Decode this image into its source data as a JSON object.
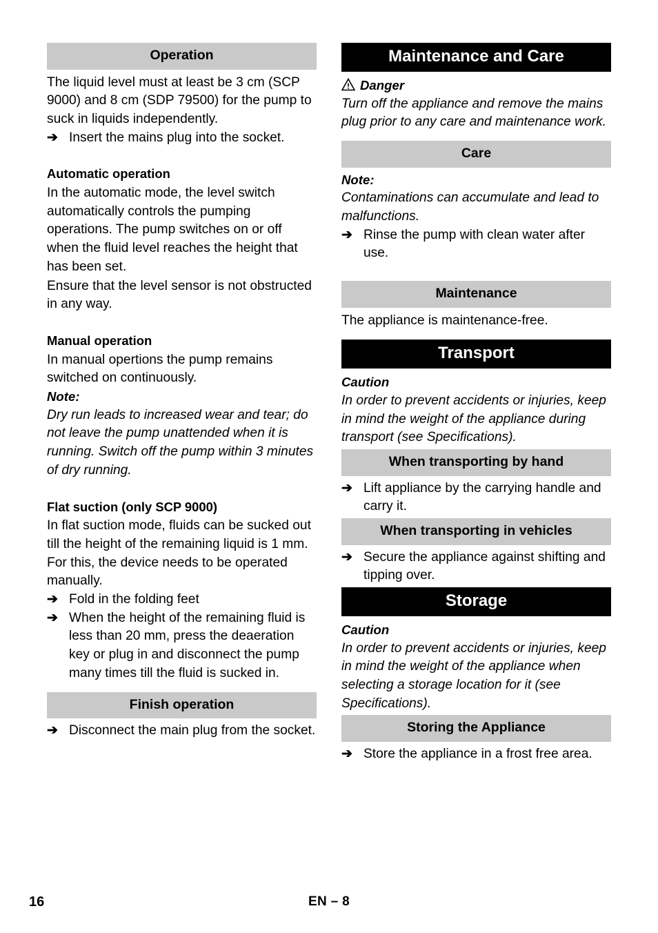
{
  "document": {
    "language_code": "EN",
    "page_number": "16",
    "footer_label": "EN – 8"
  },
  "left_column": {
    "operation_bar": "Operation",
    "intro_paragraph": "The liquid level must at least be 3 cm (SCP 9000) and 8 cm (SDP 79500) for the pump to suck in liquids independently.",
    "intro_step": "Insert the mains plug into the socket.",
    "automatic": {
      "heading": "Automatic operation",
      "paragraph_1": "In the automatic mode, the level switch automatically controls the pumping operations. The pump switches on or off when the fluid level reaches the height that has been set.",
      "paragraph_2": "Ensure that the level sensor is not obstructed in any way."
    },
    "manual": {
      "heading": "Manual operation",
      "paragraph": "In manual opertions the pump remains switched on continuously.",
      "note_label": "Note:",
      "note_text": "Dry run leads to increased wear and tear; do not leave the pump unattended when it is running. Switch off the pump within 3 minutes of dry running."
    },
    "flat_suction": {
      "heading": "Flat suction (only SCP 9000)",
      "paragraph": "In flat suction mode, fluids can be sucked out till the height of the remaining liquid is 1 mm. For this, the device needs to be operated manually.",
      "step_1": "Fold in the folding feet",
      "step_2": "When the height of the remaining fluid is less than 20 mm, press the deaeration key or plug in and disconnect the pump many times till the fluid is sucked in."
    },
    "finish": {
      "bar": "Finish operation",
      "step": "Disconnect the main plug from the socket."
    }
  },
  "right_column": {
    "maintenance_and_care": {
      "bar": "Maintenance and Care",
      "danger_label": "Danger",
      "danger_text": "Turn off the appliance and remove the mains plug prior to any care and maintenance work."
    },
    "care": {
      "bar": "Care",
      "note_label": "Note:",
      "note_text": "Contaminations can accumulate and lead to malfunctions.",
      "step": "Rinse the pump with clean water after use."
    },
    "maintenance": {
      "bar": "Maintenance",
      "text": "The appliance is maintenance-free."
    },
    "transport": {
      "bar": "Transport",
      "caution_label": "Caution",
      "caution_text": "In order to prevent accidents or injuries, keep in mind the weight of the appliance during transport (see Specifications).",
      "by_hand_bar": "When transporting by hand",
      "by_hand_step": "Lift appliance by the carrying handle and carry it.",
      "in_vehicles_bar": "When transporting in vehicles",
      "in_vehicles_step": "Secure the appliance against shifting and tipping over."
    },
    "storage": {
      "bar": "Storage",
      "caution_label": "Caution",
      "caution_text": "In order to prevent accidents or injuries, keep in mind the weight of the appliance when selecting a storage location for it (see Specifications).",
      "storing_bar": "Storing the Appliance",
      "storing_step": "Store the appliance in a frost free area."
    }
  },
  "icons": {
    "arrow": "➔",
    "warning_triangle": "warning-triangle-icon"
  },
  "colors": {
    "bar_gray": "#c9c9c9",
    "bar_black": "#000000",
    "text": "#000000",
    "page_background": "#ffffff"
  }
}
